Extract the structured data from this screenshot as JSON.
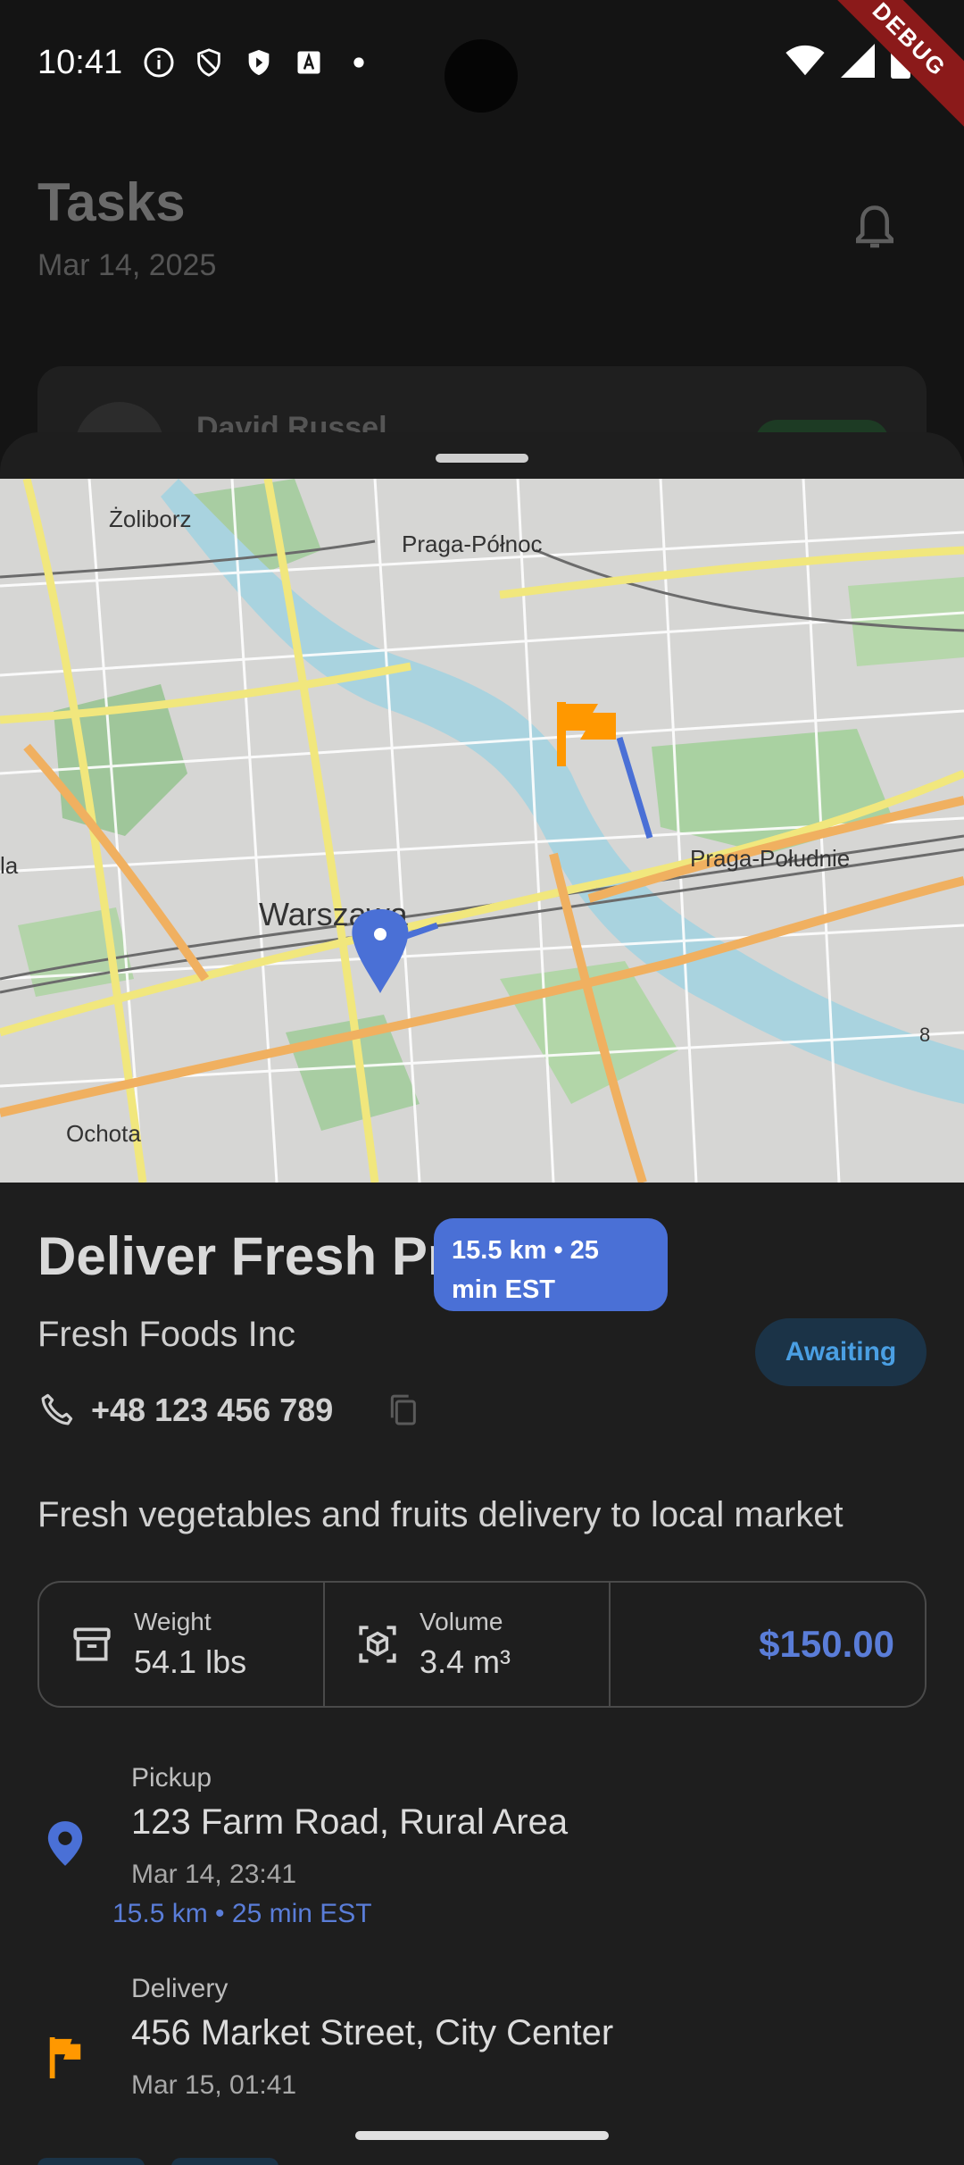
{
  "status_bar": {
    "time": "10:41",
    "debug_label": "DEBUG"
  },
  "background_page": {
    "title": "Tasks",
    "date": "Mar 14, 2025",
    "card_name": "David Russel"
  },
  "map": {
    "labels": [
      "Żoliborz",
      "Praga-Północ",
      "Praga-Południe",
      "Warszawa",
      "Ochota",
      "la",
      "8"
    ],
    "route_callout": "15.5 km • 25 min EST"
  },
  "task": {
    "title": "Deliver Fresh Produce",
    "company": "Fresh Foods Inc",
    "status": "Awaiting",
    "phone": "+48 123 456 789",
    "description": "Fresh vegetables and fruits delivery to local market",
    "stats": {
      "weight_label": "Weight",
      "weight_value": "54.1 lbs",
      "volume_label": "Volume",
      "volume_value": "3.4 m³",
      "price": "$150.00"
    },
    "pickup": {
      "label": "Pickup",
      "address": "123 Farm Road, Rural Area",
      "time": "Mar 14, 23:41",
      "distance": "15.5 km • 25 min EST"
    },
    "delivery": {
      "label": "Delivery",
      "address": "456 Market Street, City Center",
      "time": "Mar 15, 01:41"
    }
  },
  "colors": {
    "accent_blue": "#4a70d6",
    "flag_orange": "#ff9800",
    "status_badge_bg": "#1b3347",
    "status_badge_text": "#4a9fe3"
  }
}
